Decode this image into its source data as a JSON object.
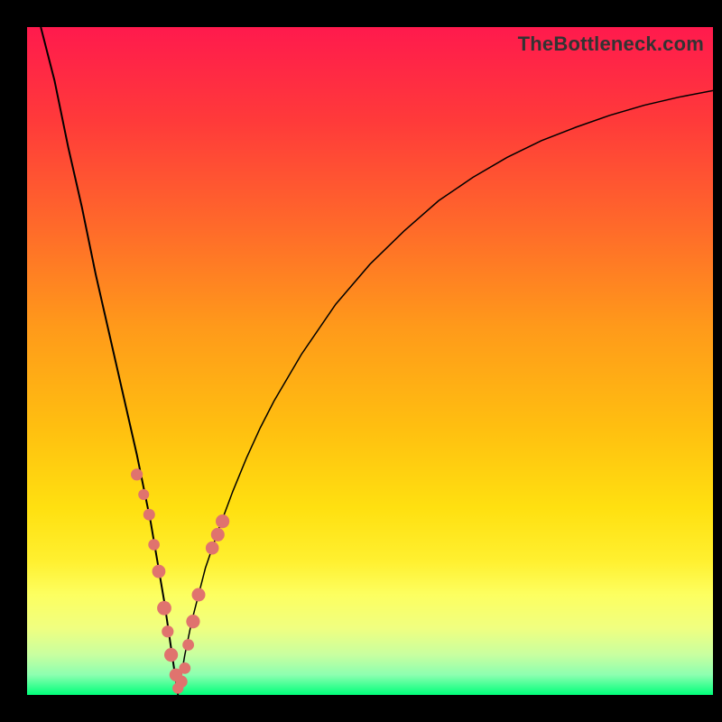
{
  "attribution": "TheBottleneck.com",
  "colors": {
    "gradient": [
      "#ff1a4d",
      "#ff3a3a",
      "#ff6a2a",
      "#ff9a1a",
      "#ffbf10",
      "#ffe010",
      "#fff030",
      "#fdff60",
      "#f0ff80",
      "#c8ffa0",
      "#8cffb0",
      "#00ff7a"
    ],
    "marker": "#e0736e",
    "curve": "#000000"
  },
  "chart_data": {
    "type": "line",
    "title": "",
    "xlabel": "",
    "ylabel": "",
    "xlim": [
      0,
      100
    ],
    "ylim": [
      0,
      100
    ],
    "x_minimum": 22,
    "series": [
      {
        "name": "bottleneck-curve",
        "x": [
          2,
          4,
          6,
          8,
          10,
          12,
          14,
          16,
          18,
          20,
          21,
          22,
          23,
          24,
          26,
          28,
          30,
          32,
          34,
          36,
          40,
          45,
          50,
          55,
          60,
          65,
          70,
          75,
          80,
          85,
          90,
          95,
          100
        ],
        "values": [
          100,
          92,
          82,
          73,
          63,
          54,
          45,
          36,
          26,
          14,
          7,
          0,
          6,
          11,
          19,
          25,
          30.5,
          35.5,
          40,
          44,
          51,
          58.5,
          64.5,
          69.5,
          74,
          77.5,
          80.5,
          83,
          85,
          86.8,
          88.3,
          89.5,
          90.5
        ]
      }
    ],
    "markers": {
      "name": "highlight-points",
      "x": [
        16,
        17,
        17.8,
        18.5,
        19.2,
        20,
        20.5,
        21,
        21.7,
        22,
        22.5,
        23,
        23.5,
        24.2,
        25,
        27,
        27.8,
        28.5
      ],
      "values": [
        33,
        30,
        27,
        22.5,
        18.5,
        13,
        9.5,
        6,
        3,
        1,
        2,
        4,
        7.5,
        11,
        15,
        22,
        24,
        26
      ]
    }
  }
}
